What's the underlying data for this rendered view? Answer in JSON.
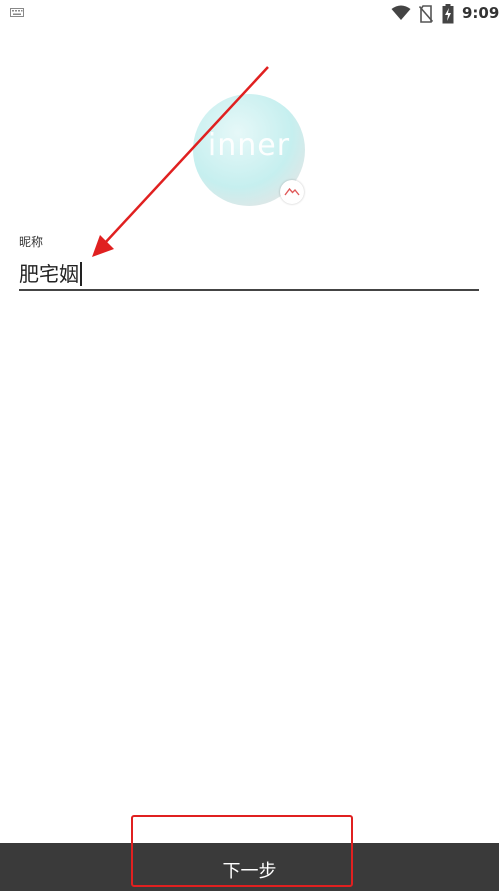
{
  "status_bar": {
    "time": "9:09",
    "icons": [
      "keyboard-icon",
      "wifi-icon",
      "no-sim-icon",
      "battery-charging-icon"
    ]
  },
  "avatar": {
    "logo_text": "inner",
    "edit_icon": "image-icon"
  },
  "nickname": {
    "label": "昵称",
    "value": "肥宅姻"
  },
  "footer": {
    "next_label": "下一步"
  },
  "colors": {
    "annotation": "#e02020",
    "button_bg": "#3a3a3a",
    "avatar_teal": "#c6efef"
  }
}
